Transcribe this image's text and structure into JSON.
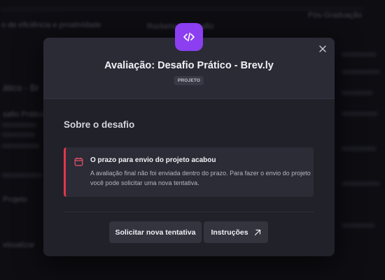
{
  "backdrop": {
    "texts": [
      "o de eficiência e proatividade",
      "Rocketseat Desafio",
      "Pós-Graduação",
      "ático - Br",
      "safio Prático",
      "Projeto",
      "visualizar"
    ]
  },
  "modal": {
    "title": "Avaliação: Desafio Prático - Brev.ly",
    "tag": "PROJETO",
    "section_title": "Sobre o desafio",
    "alert": {
      "title": "O prazo para envio do projeto acabou",
      "body": "A avaliação final não foi enviada dentro do prazo. Para fazer o envio do projeto você pode solicitar uma nova tentativa."
    },
    "buttons": {
      "retry": "Solicitar nova tentativa",
      "instructions": "Instruções"
    }
  },
  "colors": {
    "accent": "#8b3ff0",
    "alert": "#e0384b"
  },
  "icons": {
    "header": "code-icon",
    "close": "close-icon",
    "alert": "calendar-icon",
    "external": "arrow-up-right-icon"
  }
}
